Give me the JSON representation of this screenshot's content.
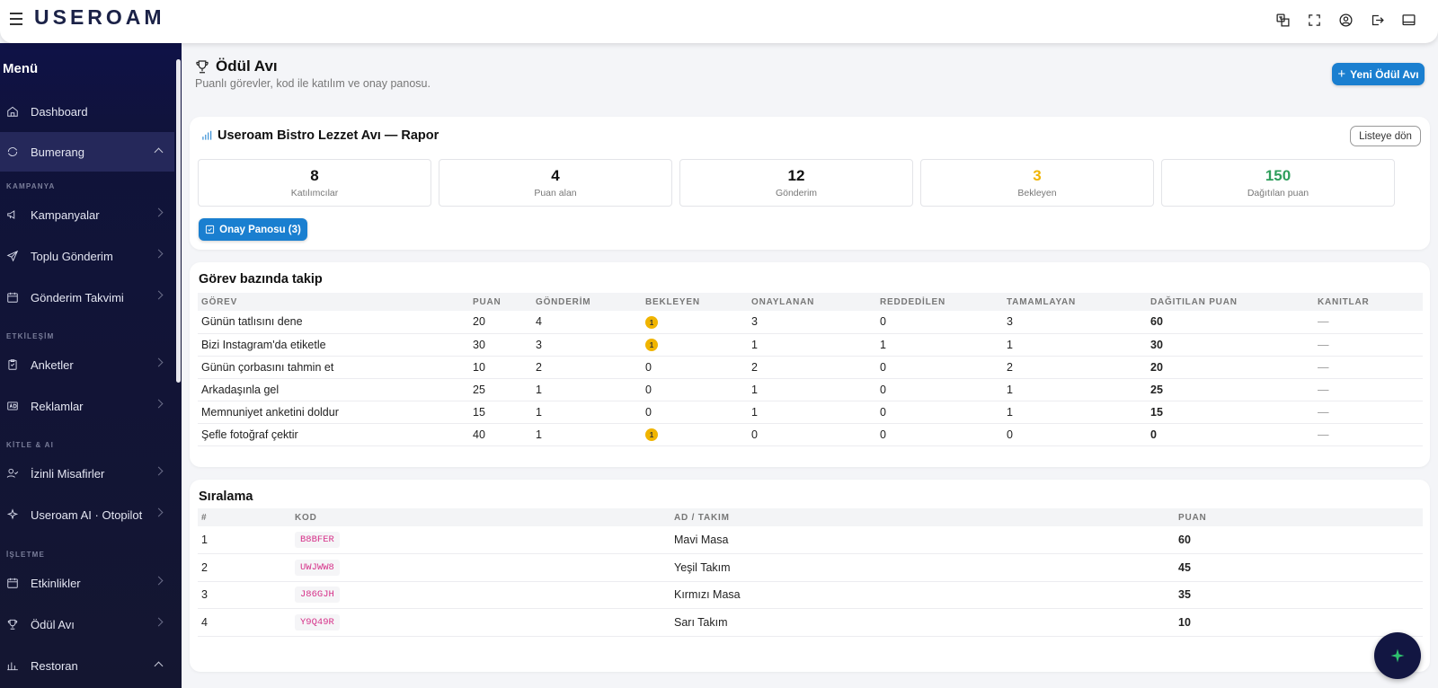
{
  "app": {
    "logo": "USEROAM"
  },
  "sidebar": {
    "menu_title": "Menü",
    "sections": {
      "kampanya": "KAMPANYA",
      "etkilesim": "ETKİLEŞİM",
      "kitle": "KİTLE & AI",
      "isletme": "İŞLETME"
    },
    "items": [
      {
        "label": "Dashboard",
        "icon": "home-icon"
      },
      {
        "label": "Bumerang",
        "icon": "refresh-icon"
      },
      {
        "label": "Kampanyalar",
        "icon": "megaphone-icon"
      },
      {
        "label": "Toplu Gönderim",
        "icon": "send-icon"
      },
      {
        "label": "Gönderim Takvimi",
        "icon": "calendar-icon"
      },
      {
        "label": "Anketler",
        "icon": "clipboard-icon"
      },
      {
        "label": "Reklamlar",
        "icon": "ad-icon"
      },
      {
        "label": "İzinli Misafirler",
        "icon": "user-check-icon"
      },
      {
        "label": "Useroam AI · Otopilot",
        "icon": "sparkle-icon"
      },
      {
        "label": "Etkinlikler",
        "icon": "calendar-event-icon"
      },
      {
        "label": "Ödül Avı",
        "icon": "trophy-icon"
      },
      {
        "label": "Restoran",
        "icon": "chart-icon"
      }
    ]
  },
  "page": {
    "title": "Ödül Avı",
    "subtitle": "Puanlı görevler, kod ile katılım ve onay panosu.",
    "new_button": "Yeni Ödül Avı"
  },
  "report": {
    "title": "Useroam Bistro Lezzet Avı — Rapor",
    "back_button": "Listeye dön",
    "stats": [
      {
        "value": "8",
        "label": "Katılımcılar",
        "color": "#111111"
      },
      {
        "value": "4",
        "label": "Puan alan",
        "color": "#111111"
      },
      {
        "value": "12",
        "label": "Gönderim",
        "color": "#111111"
      },
      {
        "value": "3",
        "label": "Bekleyen",
        "color": "#f0b400"
      },
      {
        "value": "150",
        "label": "Dağıtılan puan",
        "color": "#2e9e5b"
      }
    ],
    "approval_button": "Onay Panosu (3)"
  },
  "tasks": {
    "title": "Görev bazında takip",
    "headers": [
      "GÖREV",
      "PUAN",
      "GÖNDERİM",
      "BEKLEYEN",
      "ONAYLANAN",
      "REDDEDİLEN",
      "TAMAMLAYAN",
      "DAĞITILAN PUAN",
      "KANITLAR"
    ],
    "rows": [
      [
        "Günün tatlısını dene",
        "20",
        "4",
        "1",
        "3",
        "0",
        "3",
        "60",
        "—"
      ],
      [
        "Bizi Instagram'da etiketle",
        "30",
        "3",
        "1",
        "1",
        "1",
        "1",
        "30",
        "—"
      ],
      [
        "Günün çorbasını tahmin et",
        "10",
        "2",
        "0",
        "2",
        "0",
        "2",
        "20",
        "—"
      ],
      [
        "Arkadaşınla gel",
        "25",
        "1",
        "0",
        "1",
        "0",
        "1",
        "25",
        "—"
      ],
      [
        "Memnuniyet anketini doldur",
        "15",
        "1",
        "0",
        "1",
        "0",
        "1",
        "15",
        "—"
      ],
      [
        "Şefle fotoğraf çektir",
        "40",
        "1",
        "1",
        "0",
        "0",
        "0",
        "0",
        "—"
      ]
    ]
  },
  "ranking": {
    "title": "Sıralama",
    "headers": [
      "#",
      "KOD",
      "AD / TAKIM",
      "PUAN"
    ],
    "rows": [
      [
        "1",
        "B8BFER",
        "Mavi Masa",
        "60"
      ],
      [
        "2",
        "UWJWW8",
        "Yeşil Takım",
        "45"
      ],
      [
        "3",
        "J86GJH",
        "Kırmızı Masa",
        "35"
      ],
      [
        "4",
        "Y9Q49R",
        "Sarı Takım",
        "10"
      ]
    ]
  }
}
